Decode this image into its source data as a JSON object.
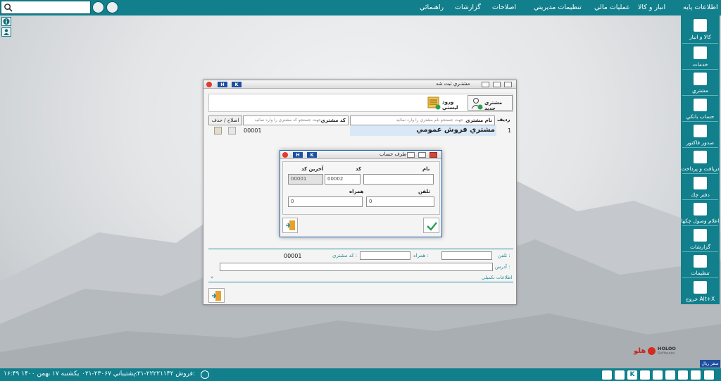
{
  "topbar": {
    "menus": [
      "اطلاعات پایه",
      "انبار و کالا",
      "عملیات مالي",
      "تنظيمات مديريتي",
      "اصلاحات",
      "گزارشات",
      "راهنمائي"
    ],
    "search_placeholder": ""
  },
  "sidebar": {
    "items": [
      {
        "label": "كالا و انبار",
        "icon": "box-icon"
      },
      {
        "label": "خدمات",
        "icon": "services-icon"
      },
      {
        "label": "مشتري",
        "icon": "customer-icon"
      },
      {
        "label": "حساب بانكي",
        "icon": "bank-icon"
      },
      {
        "label": "صدور فاكتور",
        "icon": "invoice-icon"
      },
      {
        "label": "دريافت و پرداخت",
        "icon": "payment-icon"
      },
      {
        "label": "دفتر چك",
        "icon": "checkbook-icon"
      },
      {
        "label": "اعلام وصول چكها",
        "icon": "mail-icon"
      },
      {
        "label": "گزارشات",
        "icon": "reports-icon"
      },
      {
        "label": "تنظيمات",
        "icon": "gear-icon"
      },
      {
        "label": "خروج Alt+X",
        "icon": "exit-icon"
      }
    ]
  },
  "main_window": {
    "title": "مشتـري ثبت شد",
    "hk": [
      "H",
      "K"
    ],
    "new_customer": "مشتري جديد",
    "list_entry": "ورود ليستي",
    "table": {
      "headers": {
        "row": "رديف",
        "name": "نام مشتري",
        "code": "كد مشتري",
        "edit": "اصلاح / حذف"
      },
      "name_search_placeholder": "جهت جستجو نام مشتري را وارد نمائيد",
      "code_search_placeholder": "جهت جستجو كد مشتري را وارد نمائيد",
      "rows": [
        {
          "row": "1",
          "name": "مشتري فروش عمومي",
          "code": "00001"
        }
      ]
    },
    "detail": {
      "phone_label": "تلفن :",
      "mobile_label": "همراه :",
      "code_label": "كد مشتري :",
      "code_value": "00001",
      "address_label": "آدرس :",
      "more_info": "اطلاعات تكميلي"
    }
  },
  "dialog": {
    "title": "طرف حساب",
    "hk": [
      "H",
      "K"
    ],
    "name_label": "نام",
    "code_label": "كد",
    "last_code_label": "آخرين كد",
    "code_value": "00002",
    "last_code_value": "00001",
    "phone_label": "تلفن",
    "mobile_label": "همراه",
    "phone_value": "0",
    "mobile_value": "0"
  },
  "brand": {
    "name": "HOLOO",
    "sub": "Software",
    "logo_text": "هلو"
  },
  "corner_label": "صفر ريال",
  "statusbar": {
    "datetime": "يكشنبه ۱۷ بهمن ۱۴۰۰   ۱۶:۴۹",
    "support": "۰۲۱-۲۳۰۶۷ پشتيباني:",
    "sales": "۰۲۱-۲۲۲۲۱۱۴۲ فروش:"
  },
  "colors": {
    "bar": "#117f8c",
    "accent": "#2a8d99",
    "hk_blue": "#1d4fa3",
    "close_red": "#e23a2c"
  }
}
